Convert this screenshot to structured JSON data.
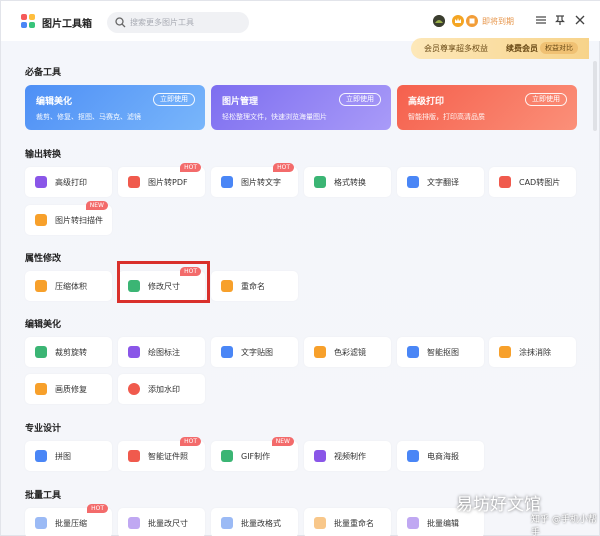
{
  "app": {
    "title": "图片工具箱"
  },
  "search": {
    "placeholder": "搜索更多图片工具"
  },
  "header": {
    "vip_link": "即将到期"
  },
  "vip_banner": {
    "text": "会员尊享超多权益",
    "renew": "续费会员",
    "compare": "权益对比"
  },
  "sections": {
    "essential": "必备工具",
    "convert": "输出转换",
    "attribute": "属性修改",
    "edit": "编辑美化",
    "pro": "专业设计",
    "batch": "批量工具"
  },
  "cards": [
    {
      "name": "编辑美化",
      "desc": "裁剪、修复、抠图、马赛克、滤镜",
      "button": "立即使用"
    },
    {
      "name": "图片管理",
      "desc": "轻松整理文件，快速浏览海量图片",
      "button": "立即使用"
    },
    {
      "name": "高级打印",
      "desc": "智能排版，打印高清品质",
      "button": "立即使用"
    }
  ],
  "convert_tools": [
    {
      "label": "高级打印"
    },
    {
      "label": "图片转PDF",
      "tag": "HOT"
    },
    {
      "label": "图片转文字",
      "tag": "HOT"
    },
    {
      "label": "格式转换"
    },
    {
      "label": "文字翻译"
    },
    {
      "label": "CAD转图片"
    },
    {
      "label": "图片转扫描件",
      "tag": "NEW"
    }
  ],
  "attribute_tools": [
    {
      "label": "压缩体积"
    },
    {
      "label": "修改尺寸",
      "tag": "HOT"
    },
    {
      "label": "重命名"
    }
  ],
  "edit_tools": [
    {
      "label": "裁剪旋转"
    },
    {
      "label": "绘图标注"
    },
    {
      "label": "文字贴图"
    },
    {
      "label": "色彩滤镜"
    },
    {
      "label": "智能抠图"
    },
    {
      "label": "涂抹消除"
    },
    {
      "label": "画质修复"
    },
    {
      "label": "添加水印"
    }
  ],
  "pro_tools": [
    {
      "label": "拼图"
    },
    {
      "label": "智能证件照",
      "tag": "HOT"
    },
    {
      "label": "GIF制作",
      "tag": "NEW"
    },
    {
      "label": "视频制作"
    },
    {
      "label": "电商海报"
    }
  ],
  "batch_tools": [
    {
      "label": "批量压缩",
      "tag": "HOT"
    },
    {
      "label": "批量改尺寸"
    },
    {
      "label": "批量改格式"
    },
    {
      "label": "批量重命名"
    },
    {
      "label": "批量编辑"
    }
  ],
  "watermark": {
    "text": "易坊好文馆",
    "sub": "知乎 @手机小帮手"
  },
  "colors": {
    "accent": "#4a86f6",
    "card1": "#5b9cf7",
    "card2": "#8a7bf2",
    "card3": "#f5735e",
    "hot": "#f36b6b",
    "highlight": "#d9302b"
  }
}
